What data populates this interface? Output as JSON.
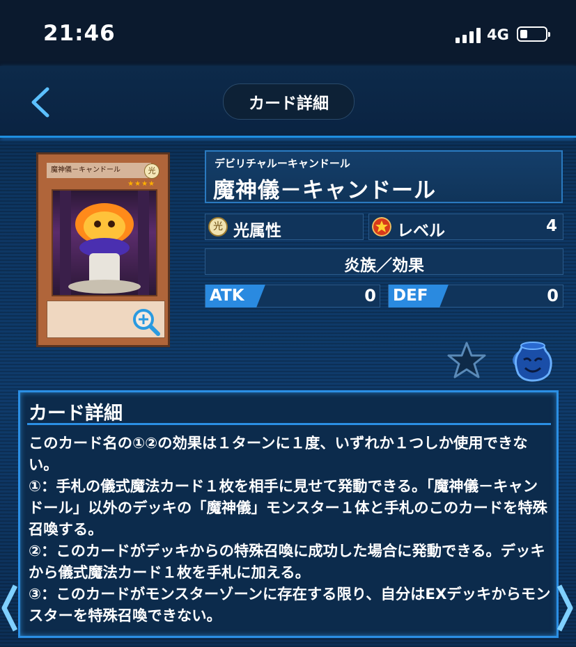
{
  "status_bar": {
    "time": "21:46",
    "network": "4G"
  },
  "header": {
    "title": "カード詳細"
  },
  "card": {
    "ruby": "デビリチャルーキャンドール",
    "name": "魔神儀－キャンドール",
    "attribute": "光属性",
    "attribute_glyph": "光",
    "level_label": "レベル",
    "level": "4",
    "type": "炎族／効果",
    "atk_label": "ATK",
    "atk": "0",
    "def_label": "DEF",
    "def": "0",
    "image_name": "魔神儀－キャンドール",
    "image_attr": "光"
  },
  "details": {
    "title": "カード詳細",
    "text": "このカード名の①②の効果は１ターンに１度、いずれか１つしか使用できない。\n①：手札の儀式魔法カード１枚を相手に見せて発動できる。「魔神儀－キャンドール」以外のデッキの「魔神儀」モンスター１体と手札のこのカードを特殊召喚する。\n②：このカードがデッキからの特殊召喚に成功した場合に発動できる。デッキから儀式魔法カード１枚を手札に加える。\n③：このカードがモンスターゾーンに存在する限り、自分はEXデッキからモンスターを特殊召喚できない。"
  },
  "icons": [
    "back-arrow-icon",
    "signal-icon",
    "battery-icon",
    "zoom-icon",
    "light-attribute-icon",
    "level-star-icon",
    "favorite-star-icon",
    "pot-icon",
    "prev-arrow-icon",
    "next-arrow-icon"
  ]
}
